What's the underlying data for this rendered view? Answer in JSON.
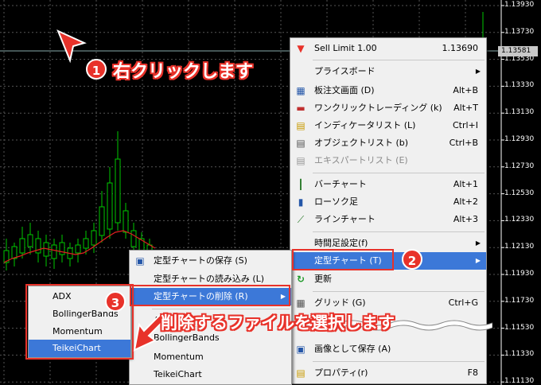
{
  "axis": {
    "price_labels": [
      "1.13930",
      "1.13730",
      "1.13530",
      "1.13330",
      "1.13130",
      "1.12930",
      "1.12730",
      "1.12530",
      "1.12330",
      "1.12130",
      "1.11930",
      "1.11730",
      "1.11530",
      "1.11330",
      "1.11130"
    ],
    "current_price": "1.13581"
  },
  "context_menu": {
    "items": [
      {
        "label": "Sell Limit 1.00",
        "shortcut": "1.13690",
        "icon": "sell-arrow-icon"
      },
      {
        "label": "プライスボード",
        "submenu": true
      },
      {
        "label": "板注文画面 (D)",
        "shortcut": "Alt+B",
        "icon": "order-board-icon"
      },
      {
        "label": "ワンクリックトレーディング (k)",
        "shortcut": "Alt+T",
        "icon": "one-click-icon"
      },
      {
        "label": "インディケータリスト (L)",
        "shortcut": "Ctrl+I",
        "icon": "indicator-list-icon"
      },
      {
        "label": "オブジェクトリスト (b)",
        "shortcut": "Ctrl+B",
        "icon": "object-list-icon"
      },
      {
        "label": "エキスパートリスト (E)",
        "disabled": true,
        "icon": "expert-list-icon"
      },
      {
        "label": "バーチャート",
        "shortcut": "Alt+1",
        "icon": "bar-chart-icon"
      },
      {
        "label": "ローソク足",
        "shortcut": "Alt+2",
        "icon": "candlestick-icon"
      },
      {
        "label": "ラインチャート",
        "shortcut": "Alt+3",
        "icon": "line-chart-icon"
      },
      {
        "label": "時間足設定(f)",
        "submenu": true
      },
      {
        "label": "定型チャート (T)",
        "submenu": true,
        "highlighted": true
      },
      {
        "label": "更新",
        "icon": "refresh-icon"
      },
      {
        "label": "グリッド (G)",
        "shortcut": "Ctrl+G",
        "icon": "grid-icon"
      },
      {
        "label": "画像として保存 (A)",
        "icon": "save-image-icon"
      },
      {
        "label": "プロパティ(r)",
        "shortcut": "F8",
        "icon": "properties-icon"
      }
    ]
  },
  "template_menu": {
    "items": [
      {
        "label": "定型チャートの保存 (S)",
        "icon": "save-template-icon"
      },
      {
        "label": "定型チャートの読み込み (L)"
      },
      {
        "label": "定型チャートの削除 (R)",
        "submenu": true,
        "highlighted": true
      },
      {
        "label": "ADX"
      },
      {
        "label": "BollingerBands"
      },
      {
        "label": "Momentum"
      },
      {
        "label": "TeikeiChart"
      }
    ]
  },
  "delete_menu": {
    "items": [
      {
        "label": "ADX"
      },
      {
        "label": "BollingerBands"
      },
      {
        "label": "Momentum"
      },
      {
        "label": "TeikeiChart",
        "highlighted": true
      }
    ]
  },
  "annotations": {
    "step1_number": "1",
    "step1_text": "右クリックします",
    "step2_number": "2",
    "step3_number": "3",
    "step3_text": "削除するファイルを選択します"
  },
  "colors": {
    "accent_red": "#e8322a",
    "highlight_blue": "#3c78d8",
    "candle_up": "#00c800",
    "grid": "#3a3a3a"
  }
}
